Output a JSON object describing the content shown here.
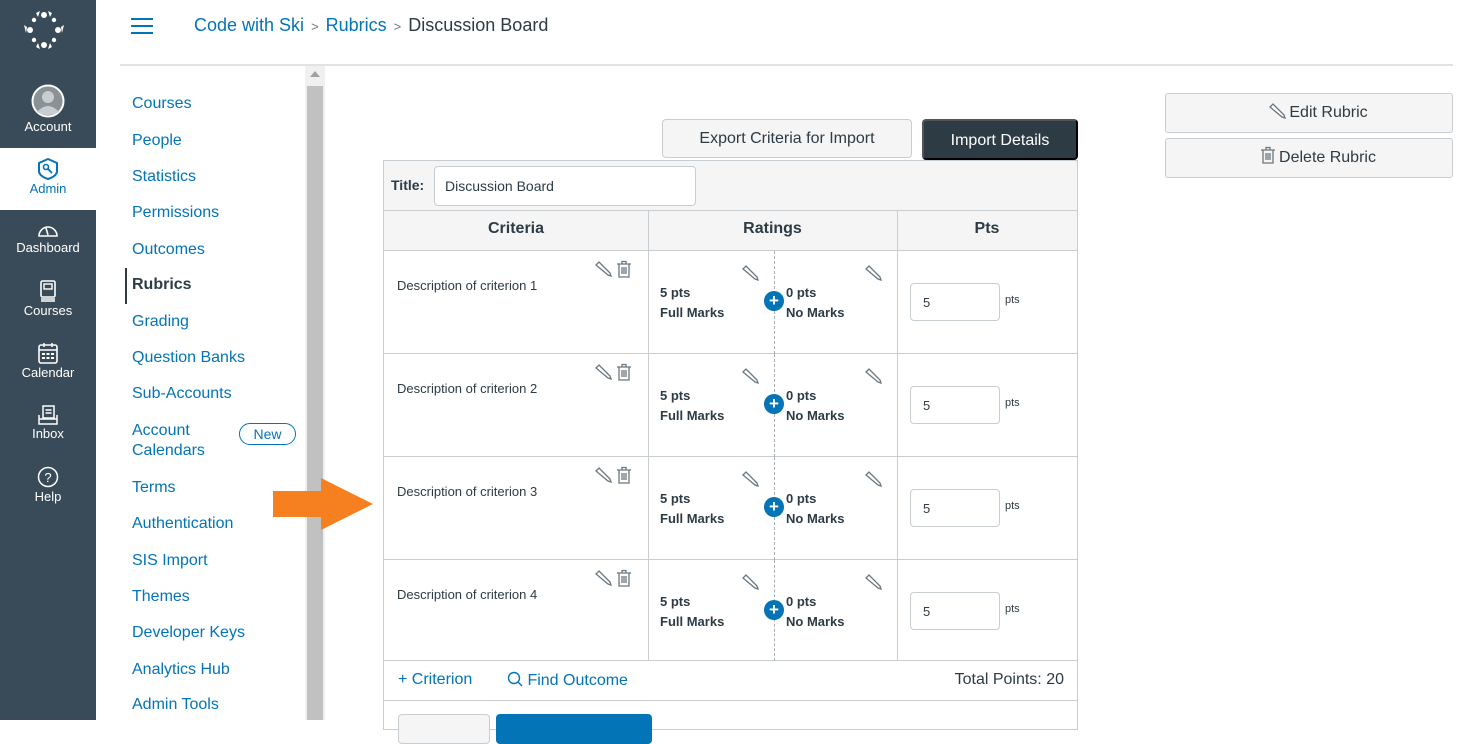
{
  "global_nav": {
    "logo": "canvas-logo-icon",
    "items": [
      {
        "label": "Account",
        "icon": "avatar-icon"
      },
      {
        "label": "Admin",
        "icon": "admin-shield-key-icon",
        "active": true
      },
      {
        "label": "Dashboard",
        "icon": "dashboard-gauge-icon"
      },
      {
        "label": "Courses",
        "icon": "courses-book-icon"
      },
      {
        "label": "Calendar",
        "icon": "calendar-icon"
      },
      {
        "label": "Inbox",
        "icon": "inbox-icon"
      },
      {
        "label": "Help",
        "icon": "help-question-icon"
      }
    ]
  },
  "header": {
    "menu_icon": "hamburger-icon",
    "breadcrumb": [
      {
        "label": "Code with Ski",
        "link": true
      },
      {
        "label": "Rubrics",
        "link": true
      },
      {
        "label": "Discussion Board",
        "link": false
      }
    ],
    "separator": ">"
  },
  "subnav": {
    "items": [
      {
        "label": "Courses"
      },
      {
        "label": "People"
      },
      {
        "label": "Statistics"
      },
      {
        "label": "Permissions"
      },
      {
        "label": "Outcomes"
      },
      {
        "label": "Rubrics",
        "active": true
      },
      {
        "label": "Grading"
      },
      {
        "label": "Question Banks"
      },
      {
        "label": "Sub-Accounts"
      },
      {
        "label": "Account Calendars",
        "line1": "Account",
        "line2": "Calendars",
        "badge": "New"
      },
      {
        "label": "Terms"
      },
      {
        "label": "Authentication"
      },
      {
        "label": "SIS Import"
      },
      {
        "label": "Themes"
      },
      {
        "label": "Developer Keys"
      },
      {
        "label": "Analytics Hub"
      },
      {
        "label": "Admin Tools"
      }
    ]
  },
  "annotation": {
    "arrow_color": "#f6801f"
  },
  "toolbar": {
    "export_label": "Export Criteria for Import",
    "import_label": "Import Details"
  },
  "rubric": {
    "title_label": "Title:",
    "title_value": "Discussion Board",
    "columns": [
      "Criteria",
      "Ratings",
      "Pts"
    ],
    "criteria": [
      {
        "description": "Description of criterion 1",
        "ratings": [
          {
            "points": "5 pts",
            "label": "Full Marks"
          },
          {
            "points": "0 pts",
            "label": "No Marks"
          }
        ],
        "points": "5",
        "points_unit": "pts"
      },
      {
        "description": "Description of criterion 2",
        "ratings": [
          {
            "points": "5 pts",
            "label": "Full Marks"
          },
          {
            "points": "0 pts",
            "label": "No Marks"
          }
        ],
        "points": "5",
        "points_unit": "pts"
      },
      {
        "description": "Description of criterion 3",
        "ratings": [
          {
            "points": "5 pts",
            "label": "Full Marks"
          },
          {
            "points": "0 pts",
            "label": "No Marks"
          }
        ],
        "points": "5",
        "points_unit": "pts"
      },
      {
        "description": "Description of criterion 4",
        "ratings": [
          {
            "points": "5 pts",
            "label": "Full Marks"
          },
          {
            "points": "0 pts",
            "label": "No Marks"
          }
        ],
        "points": "5",
        "points_unit": "pts"
      }
    ],
    "add_criterion_label": "+ Criterion",
    "find_outcome_label": "Find Outcome",
    "total_points_label": "Total Points: 20"
  },
  "side_actions": {
    "edit_label": "Edit Rubric",
    "delete_label": "Delete Rubric"
  },
  "colors": {
    "nav_bg": "#394b58",
    "link": "#0374b5",
    "dark_button": "#2d3b45",
    "arrow": "#f6801f"
  }
}
